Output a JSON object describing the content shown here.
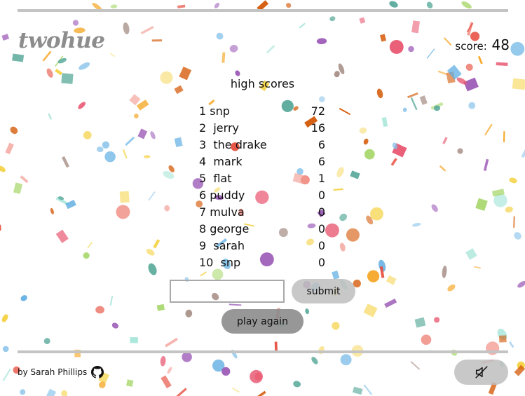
{
  "header": {
    "logo": "twohue",
    "score_label": "score:",
    "score_value": "48"
  },
  "high_scores": {
    "title": "high scores",
    "entries": [
      {
        "name": "1 snp",
        "score": "72"
      },
      {
        "name": "2  jerry",
        "score": "16"
      },
      {
        "name": "3  the drake",
        "score": "6"
      },
      {
        "name": "4  mark",
        "score": "6"
      },
      {
        "name": "5  flat",
        "score": "1"
      },
      {
        "name": "6 puddy",
        "score": "0"
      },
      {
        "name": "7 mulva",
        "score": "0"
      },
      {
        "name": "8 george",
        "score": "0"
      },
      {
        "name": "9  sarah",
        "score": "0"
      },
      {
        "name": "10  snp",
        "score": "0"
      }
    ]
  },
  "form": {
    "name_value": "",
    "submit_label": "submit"
  },
  "play_again_label": "play again",
  "footer": {
    "credit": "by Sarah Phillips",
    "github_icon": "github-icon",
    "mute_icon": "speaker-muted-icon"
  },
  "colors": {
    "rule": "#c4c4c4",
    "logo": "#8d8d8d",
    "button_light": "#bebebe",
    "button_dark": "#8c8c8c",
    "confetti": [
      "#e8546f",
      "#f4d03f",
      "#a9d86e",
      "#85c1e9",
      "#9b59b6",
      "#f5a623",
      "#5dade2",
      "#f1948a",
      "#58a99a",
      "#d35400",
      "#e74c3c",
      "#a1887f",
      "#a3e4d7",
      "#f7dc6f"
    ]
  }
}
